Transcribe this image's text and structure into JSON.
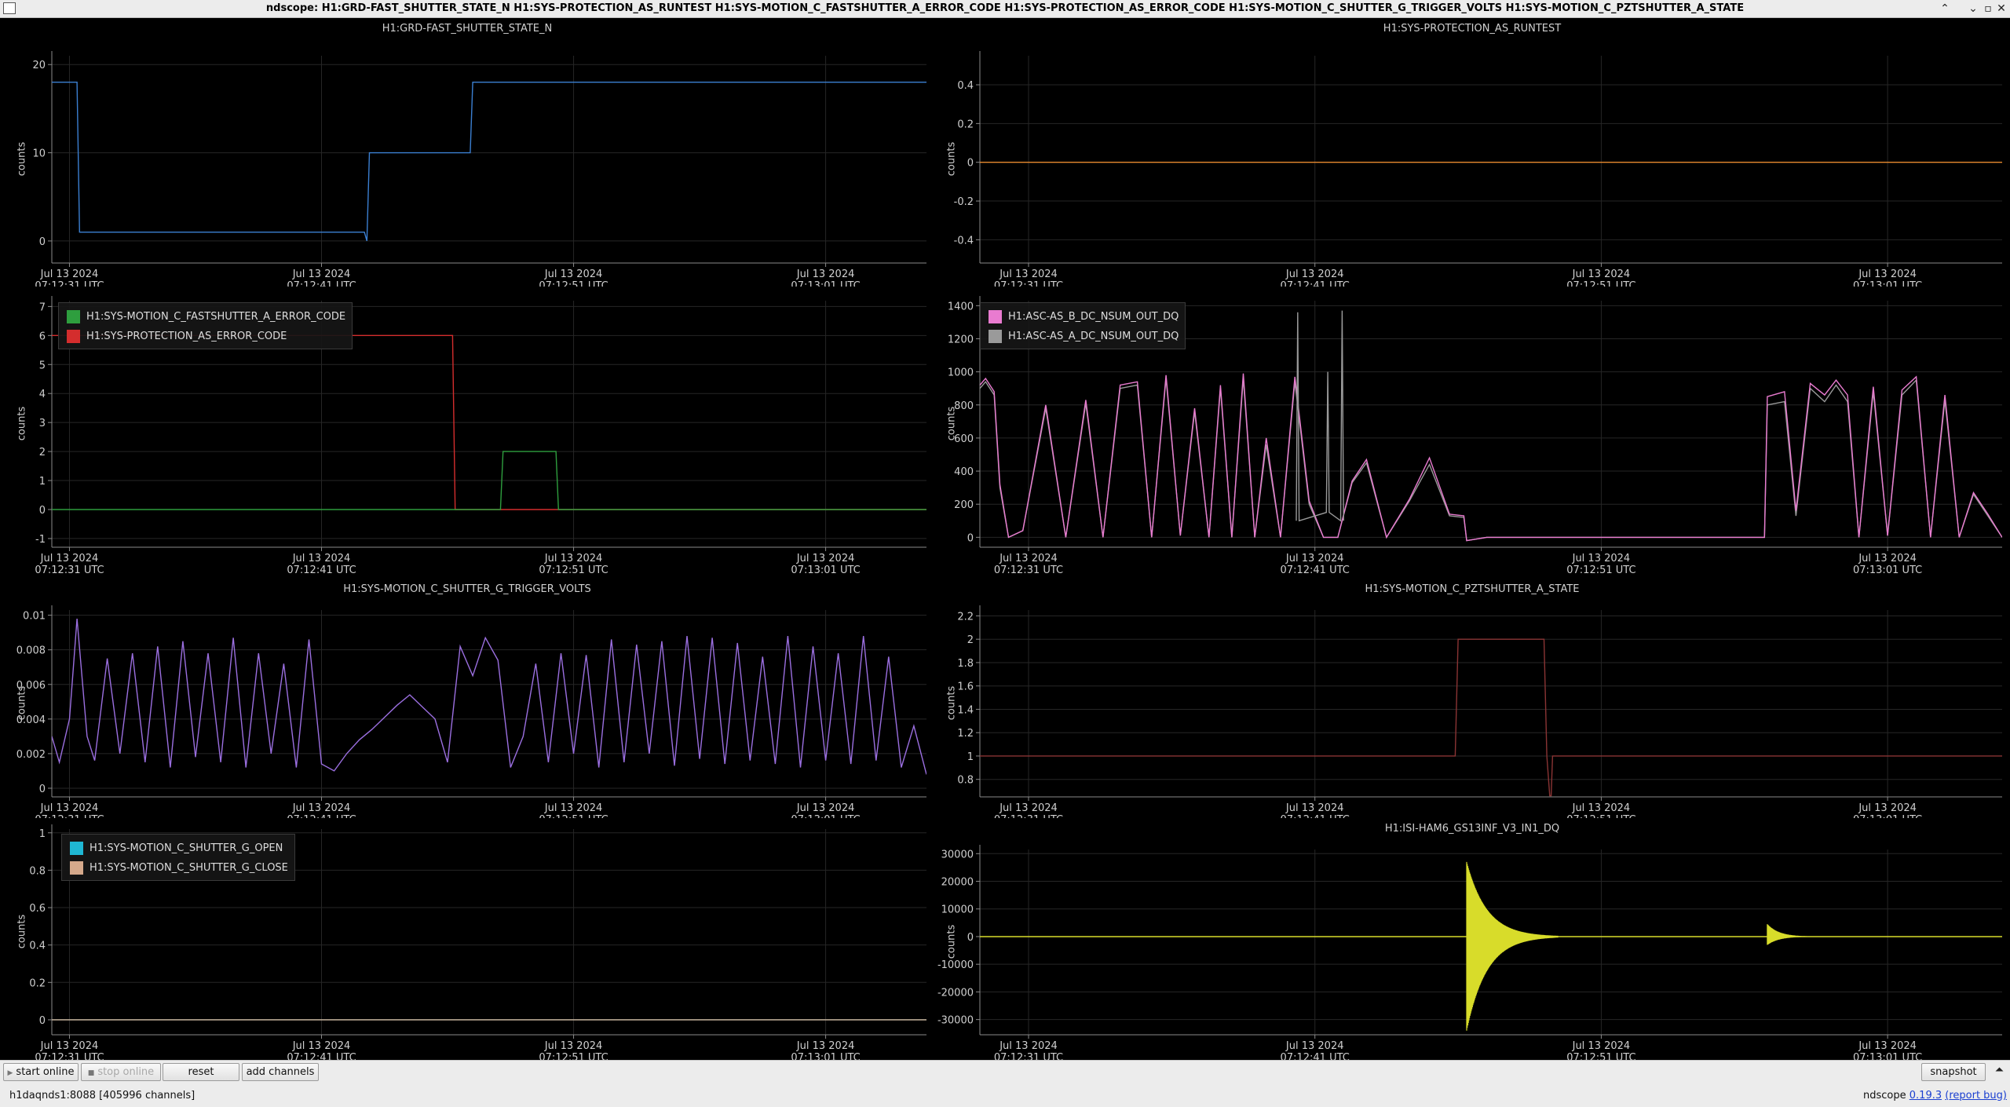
{
  "window": {
    "title": "ndscope: H1:GRD-FAST_SHUTTER_STATE_N H1:SYS-PROTECTION_AS_RUNTEST H1:SYS-MOTION_C_FASTSHUTTER_A_ERROR_CODE H1:SYS-PROTECTION_AS_ERROR_CODE H1:SYS-MOTION_C_SHUTTER_G_TRIGGER_VOLTS H1:SYS-MOTION_C_PZTSHUTTER_A_STATE",
    "minimize": "⌃",
    "maximize": "⌄",
    "restore": "▫",
    "close": "✕"
  },
  "toolbar": {
    "start_online": "start online",
    "stop_online": "stop online",
    "reset": "reset",
    "add_channels": "add channels",
    "snapshot": "snapshot",
    "collapse": "⏶"
  },
  "status": {
    "server": "h1daqnds1:8088  [405996 channels]",
    "app": "ndscope",
    "version": "0.19.3",
    "report": "(report bug)"
  },
  "time_axis": {
    "ticks": [
      {
        "date": "Jul 13 2024",
        "time": "07:12:31 UTC"
      },
      {
        "date": "Jul 13 2024",
        "time": "07:12:41 UTC"
      },
      {
        "date": "Jul 13 2024",
        "time": "07:12:51 UTC"
      },
      {
        "date": "Jul 13 2024",
        "time": "07:13:01 UTC"
      }
    ]
  },
  "plots": [
    {
      "title": "H1:GRD-FAST_SHUTTER_STATE_N",
      "ylabel": "counts",
      "legend": [],
      "chart_data": {
        "type": "line",
        "x_unit": "seconds after 07:12:31 UTC",
        "xlim": [
          -0.7,
          34
        ],
        "ylim": [
          -2.5,
          21
        ],
        "yticks": [
          0,
          10,
          20
        ],
        "grid": true,
        "series": [
          {
            "color": "#3b7fd1",
            "x": [
              -0.7,
              0.3,
              0.4,
              1.0,
              11.7,
              11.8,
              11.9,
              15.9,
              16.0,
              34.0
            ],
            "y": [
              18,
              18,
              1,
              1,
              1,
              0,
              10,
              10,
              18,
              18
            ]
          }
        ]
      }
    },
    {
      "title": "H1:SYS-PROTECTION_AS_RUNTEST",
      "ylabel": "counts",
      "legend": [],
      "chart_data": {
        "type": "line",
        "x_unit": "seconds after 07:12:31 UTC",
        "xlim": [
          -1.7,
          34
        ],
        "ylim": [
          -0.52,
          0.55
        ],
        "yticks": [
          -0.4,
          -0.2,
          0,
          0.2,
          0.4
        ],
        "grid": true,
        "series": [
          {
            "color": "#e88a2e",
            "x": [
              -1.7,
              34
            ],
            "y": [
              0,
              0
            ]
          }
        ]
      }
    },
    {
      "title": "",
      "ylabel": "counts",
      "legend": [
        {
          "label": "H1:SYS-MOTION_C_FASTSHUTTER_A_ERROR_CODE",
          "color": "#2e9e3e"
        },
        {
          "label": "H1:SYS-PROTECTION_AS_ERROR_CODE",
          "color": "#d42d2d"
        }
      ],
      "chart_data": {
        "type": "line",
        "x_unit": "seconds after 07:12:31 UTC",
        "xlim": [
          -0.7,
          34
        ],
        "ylim": [
          -1.3,
          7.2
        ],
        "yticks": [
          -1,
          0,
          1,
          2,
          3,
          4,
          5,
          6,
          7
        ],
        "grid": true,
        "series": [
          {
            "color": "#d42d2d",
            "x": [
              -0.7,
              15.2,
              15.3,
              34
            ],
            "y": [
              6,
              6,
              0,
              0
            ]
          },
          {
            "color": "#2e9e3e",
            "x": [
              -0.7,
              17.1,
              17.2,
              19.3,
              19.4,
              34
            ],
            "y": [
              0,
              0,
              2,
              2,
              0,
              0
            ]
          }
        ]
      }
    },
    {
      "title": "",
      "ylabel": "counts",
      "legend": [
        {
          "label": "H1:ASC-AS_B_DC_NSUM_OUT_DQ",
          "color": "#e97bd0"
        },
        {
          "label": "H1:ASC-AS_A_DC_NSUM_OUT_DQ",
          "color": "#9a9a9a"
        }
      ],
      "chart_data": {
        "type": "line",
        "x_unit": "seconds after 07:12:31 UTC",
        "xlim": [
          -1.7,
          34
        ],
        "ylim": [
          -60,
          1430
        ],
        "yticks": [
          0,
          200,
          400,
          600,
          800,
          1000,
          1200,
          1400
        ],
        "grid": true,
        "series": [
          {
            "color": "#9a9a9a",
            "x": [
              -1.7,
              -1.5,
              -1.2,
              -1.0,
              -0.7,
              -0.2,
              0.6,
              1.3,
              2.0,
              2.6,
              3.2,
              3.8,
              4.3,
              4.8,
              5.3,
              5.8,
              6.3,
              6.7,
              7.1,
              7.5,
              7.9,
              8.3,
              8.8,
              9.3,
              9.8,
              10.3,
              10.8,
              11.3,
              11.8,
              12.5,
              13.3,
              14.0,
              14.7,
              15.2,
              15.3,
              16.0,
              18.0,
              20.0,
              22.0,
              24.0,
              25.7,
              25.8,
              26.4,
              26.8,
              27.3,
              27.8,
              28.2,
              28.6,
              29.0,
              29.5,
              30.0,
              30.5,
              31.0,
              31.5,
              32.0,
              32.5,
              33.0,
              33.5,
              34.0
            ],
            "y": [
              900,
              940,
              860,
              300,
              0,
              40,
              780,
              0,
              810,
              0,
              900,
              920,
              0,
              960,
              10,
              760,
              0,
              900,
              0,
              960,
              0,
              560,
              0,
              940,
              200,
              0,
              0,
              330,
              450,
              0,
              220,
              440,
              130,
              120,
              -20,
              0,
              0,
              0,
              0,
              0,
              0,
              800,
              820,
              130,
              900,
              820,
              920,
              820,
              0,
              880,
              10,
              860,
              950,
              0,
              830,
              0,
              260,
              130,
              0
            ]
          },
          {
            "color": "#e97bd0",
            "x": [
              -1.7,
              -1.5,
              -1.2,
              -1.0,
              -0.7,
              -0.2,
              0.6,
              1.3,
              2.0,
              2.6,
              3.2,
              3.8,
              4.3,
              4.8,
              5.3,
              5.8,
              6.3,
              6.7,
              7.1,
              7.5,
              7.9,
              8.3,
              8.8,
              9.3,
              9.8,
              10.3,
              10.8,
              11.3,
              11.8,
              12.5,
              13.3,
              14.0,
              14.7,
              15.2,
              15.3,
              16.0,
              18.0,
              20.0,
              22.0,
              24.0,
              25.7,
              25.8,
              26.4,
              26.8,
              27.3,
              27.8,
              28.2,
              28.6,
              29.0,
              29.5,
              30.0,
              30.5,
              31.0,
              31.5,
              32.0,
              32.5,
              33.0,
              33.5,
              34.0
            ],
            "y": [
              920,
              960,
              880,
              320,
              0,
              40,
              800,
              0,
              830,
              0,
              920,
              940,
              0,
              980,
              10,
              780,
              0,
              920,
              0,
              990,
              0,
              600,
              0,
              970,
              220,
              0,
              0,
              340,
              470,
              0,
              230,
              480,
              140,
              130,
              -20,
              0,
              0,
              0,
              0,
              0,
              0,
              850,
              880,
              160,
              930,
              860,
              950,
              860,
              0,
              910,
              10,
              890,
              970,
              0,
              860,
              0,
              270,
              140,
              0
            ]
          },
          {
            "color": "#9a9a9a",
            "x": [
              9.35,
              9.4,
              9.45,
              10.4,
              10.45,
              10.5,
              10.9,
              10.95,
              11.0
            ],
            "y": [
              100,
              1360,
              100,
              150,
              1000,
              150,
              100,
              1370,
              100
            ]
          }
        ]
      }
    },
    {
      "title": "H1:SYS-MOTION_C_SHUTTER_G_TRIGGER_VOLTS",
      "ylabel": "counts",
      "legend": [],
      "chart_data": {
        "type": "line",
        "x_unit": "seconds after 07:12:31 UTC",
        "xlim": [
          -0.7,
          34
        ],
        "ylim": [
          -0.0005,
          0.0103
        ],
        "yticks": [
          0,
          0.002,
          0.004,
          0.006,
          0.008,
          0.01
        ],
        "grid": true,
        "series": [
          {
            "color": "#9b6fe0",
            "x": [
              -0.7,
              -0.4,
              0.0,
              0.3,
              0.7,
              1.0,
              1.5,
              2.0,
              2.5,
              3.0,
              3.5,
              4.0,
              4.5,
              5.0,
              5.5,
              6.0,
              6.5,
              7.0,
              7.5,
              8.0,
              8.5,
              9.0,
              9.5,
              10.0,
              10.5,
              11.0,
              11.5,
              12.0,
              12.5,
              13.0,
              13.5,
              14.0,
              14.5,
              15.0,
              15.5,
              16.0,
              16.5,
              17.0,
              17.5,
              18.0,
              18.5,
              19.0,
              19.5,
              20.0,
              20.5,
              21.0,
              21.5,
              22.0,
              22.5,
              23.0,
              23.5,
              24.0,
              24.5,
              25.0,
              25.5,
              26.0,
              26.5,
              27.0,
              27.5,
              28.0,
              28.5,
              29.0,
              29.5,
              30.0,
              30.5,
              31.0,
              31.5,
              32.0,
              32.5,
              33.0,
              33.5,
              34.0
            ],
            "y": [
              0.003,
              0.0015,
              0.004,
              0.0098,
              0.003,
              0.0016,
              0.0075,
              0.002,
              0.0078,
              0.0015,
              0.0082,
              0.0012,
              0.0085,
              0.0018,
              0.0078,
              0.0015,
              0.0087,
              0.0012,
              0.0078,
              0.002,
              0.0072,
              0.0012,
              0.0086,
              0.0014,
              0.001,
              0.002,
              0.0028,
              0.0034,
              0.0041,
              0.0048,
              0.0054,
              0.0047,
              0.004,
              0.0015,
              0.0082,
              0.0065,
              0.0087,
              0.0074,
              0.0012,
              0.003,
              0.0072,
              0.0015,
              0.0078,
              0.002,
              0.0077,
              0.0012,
              0.0086,
              0.0015,
              0.0083,
              0.002,
              0.0085,
              0.0013,
              0.0088,
              0.0017,
              0.0087,
              0.0014,
              0.0084,
              0.0016,
              0.0076,
              0.0014,
              0.0088,
              0.0012,
              0.0082,
              0.0016,
              0.0078,
              0.0014,
              0.0088,
              0.0016,
              0.0076,
              0.0012,
              0.0036,
              0.0008
            ]
          }
        ]
      }
    },
    {
      "title": "H1:SYS-MOTION_C_PZTSHUTTER_A_STATE",
      "ylabel": "counts",
      "legend": [],
      "chart_data": {
        "type": "line",
        "x_unit": "seconds after 07:12:31 UTC",
        "xlim": [
          -1.7,
          34
        ],
        "ylim": [
          0.65,
          2.25
        ],
        "yticks": [
          0.8,
          1,
          1.2,
          1.4,
          1.6,
          1.8,
          2,
          2.2
        ],
        "grid": true,
        "series": [
          {
            "color": "#8a3434",
            "x": [
              -1.7,
              14.9,
              15.0,
              18.0,
              18.1,
              18.2,
              18.25,
              18.3,
              34.0
            ],
            "y": [
              1,
              1,
              2,
              2,
              1,
              0.66,
              0.66,
              1,
              1
            ]
          }
        ]
      }
    },
    {
      "title": "",
      "ylabel": "counts",
      "legend": [
        {
          "label": "H1:SYS-MOTION_C_SHUTTER_G_OPEN",
          "color": "#1fb7d3"
        },
        {
          "label": "H1:SYS-MOTION_C_SHUTTER_G_CLOSE",
          "color": "#d5a98b"
        }
      ],
      "chart_data": {
        "type": "line",
        "x_unit": "seconds after 07:12:31 UTC",
        "xlim": [
          -0.7,
          34
        ],
        "ylim": [
          -0.08,
          1.02
        ],
        "yticks": [
          0,
          0.2,
          0.4,
          0.6,
          0.8,
          1
        ],
        "grid": true,
        "series": [
          {
            "color": "#1fb7d3",
            "x": [
              -0.7,
              34
            ],
            "y": [
              0,
              0
            ]
          },
          {
            "color": "#d5a98b",
            "x": [
              -0.7,
              34
            ],
            "y": [
              0,
              0
            ]
          }
        ]
      }
    },
    {
      "title": "H1:ISI-HAM6_GS13INF_V3_IN1_DQ",
      "ylabel": "counts",
      "legend": [],
      "chart_data": {
        "type": "line",
        "x_unit": "seconds after 07:12:31 UTC",
        "xlim": [
          -1.7,
          34
        ],
        "ylim": [
          -35500,
          31500
        ],
        "yticks": [
          -30000,
          -20000,
          -10000,
          0,
          10000,
          20000,
          30000
        ],
        "grid": true,
        "series": [
          {
            "color": "#d8dc2a",
            "x": [
              -1.7,
              34
            ],
            "y": [
              0,
              0
            ]
          }
        ],
        "bursts": [
          {
            "t": 15.3,
            "amp_pos": 27000,
            "amp_neg": 34000,
            "decay_s": 0.7
          },
          {
            "t": 25.8,
            "amp_pos": 4500,
            "amp_neg": 3000,
            "decay_s": 0.4
          }
        ]
      }
    }
  ]
}
